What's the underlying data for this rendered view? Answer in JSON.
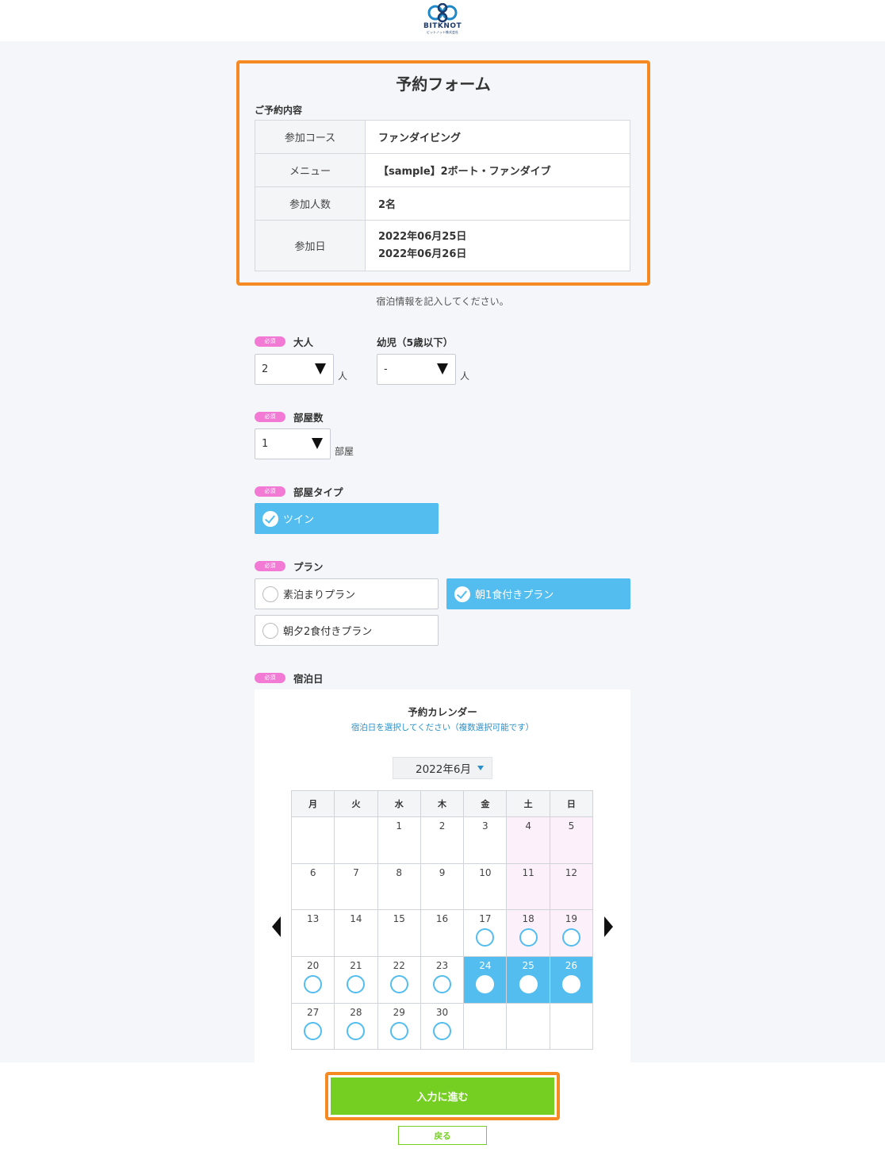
{
  "header": {
    "logo_text": "BITKNOT",
    "logo_sub": "ビットノット株式会社"
  },
  "summary": {
    "title": "予約フォーム",
    "heading": "ご予約内容",
    "rows": [
      {
        "label": "参加コース",
        "value": "ファンダイビング"
      },
      {
        "label": "メニュー",
        "value": "【sample】2ボート・ファンダイブ"
      },
      {
        "label": "参加人数",
        "value": "2名"
      },
      {
        "label": "参加日",
        "values": [
          "2022年06月25日",
          "2022年06月26日"
        ]
      }
    ]
  },
  "instruction": "宿泊情報を記入してください。",
  "required_badge": "必須",
  "adults": {
    "label": "大人",
    "value": "2",
    "unit": "人"
  },
  "infants": {
    "label": "幼児（5歳以下）",
    "value": "-",
    "unit": "人"
  },
  "rooms": {
    "label": "部屋数",
    "value": "1",
    "unit": "部屋"
  },
  "room_type": {
    "label": "部屋タイプ",
    "options": [
      {
        "label": "ツイン",
        "selected": true
      }
    ]
  },
  "plan": {
    "label": "プラン",
    "options": [
      {
        "label": "素泊まりプラン",
        "selected": false
      },
      {
        "label": "朝1食付きプラン",
        "selected": true
      },
      {
        "label": "朝夕2食付きプラン",
        "selected": false
      }
    ]
  },
  "stay": {
    "label": "宿泊日"
  },
  "calendar": {
    "title": "予約カレンダー",
    "subtitle": "宿泊日を選択してください（複数選択可能です）",
    "month": "2022年6月",
    "weekdays": [
      "月",
      "火",
      "水",
      "木",
      "金",
      "土",
      "日"
    ],
    "weeks": [
      [
        "",
        "",
        "1",
        "2",
        "3",
        "4",
        "5"
      ],
      [
        "6",
        "7",
        "8",
        "9",
        "10",
        "11",
        "12"
      ],
      [
        "13",
        "14",
        "15",
        "16",
        "17",
        "18",
        "19"
      ],
      [
        "20",
        "21",
        "22",
        "23",
        "24",
        "25",
        "26"
      ],
      [
        "27",
        "28",
        "29",
        "30",
        "",
        "",
        ""
      ]
    ],
    "available_days": [
      "17",
      "18",
      "19",
      "20",
      "21",
      "22",
      "23",
      "24",
      "25",
      "26",
      "27",
      "28",
      "29",
      "30"
    ],
    "selected_days": [
      "24",
      "25",
      "26"
    ],
    "colors": {
      "accent": "#52bdee",
      "weekend": "#fcf0fb"
    }
  },
  "buttons": {
    "next": "入力に進む",
    "back": "戻る"
  },
  "colors": {
    "highlight": "#f58a22",
    "primary_green": "#74cf22",
    "required": "#f279d4"
  }
}
